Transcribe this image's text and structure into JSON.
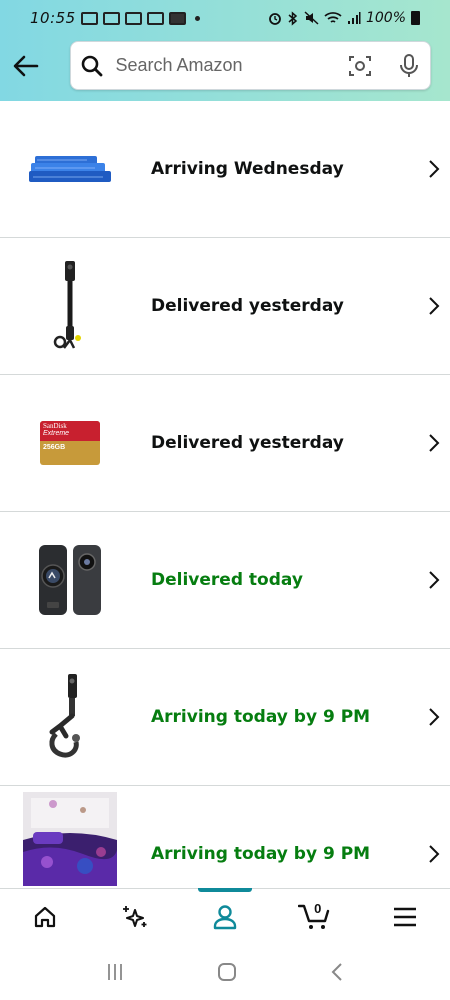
{
  "status_bar": {
    "time": "10:55",
    "battery_percent": "100%"
  },
  "header": {
    "back_icon": "arrow-left-icon",
    "search": {
      "placeholder": "Search Amazon",
      "icons": [
        "search-icon",
        "camera-scan-icon",
        "microphone-icon"
      ]
    }
  },
  "orders": [
    {
      "status": "Arriving Wednesday",
      "status_color": "#0f1111",
      "product": "blue bed sheet set"
    },
    {
      "status": "Delivered yesterday",
      "status_color": "#0f1111",
      "product": "selfie stick"
    },
    {
      "status": "Delivered yesterday",
      "status_color": "#0f1111",
      "product": "SanDisk Extreme memory card",
      "card_text": {
        "brand": "SanDisk",
        "line": "Extreme",
        "capacity": "256GB"
      }
    },
    {
      "status": "Delivered today",
      "status_color": "#067d10",
      "product": "360 camera"
    },
    {
      "status": "Arriving today by 9 PM",
      "status_color": "#067d10",
      "product": "camera clamp mount"
    },
    {
      "status": "Arriving today by 9 PM",
      "status_color": "#067d10",
      "product": "galaxy comforter set"
    }
  ],
  "bottom_nav": {
    "items": [
      "home-icon",
      "sparkle-icon",
      "account-icon",
      "cart-icon",
      "menu-icon"
    ],
    "active": "account-icon",
    "cart_count": "0",
    "accent": "#0f8a9a"
  },
  "system_nav": [
    "recent-apps-icon",
    "home-circle-icon",
    "back-chevron-icon"
  ]
}
